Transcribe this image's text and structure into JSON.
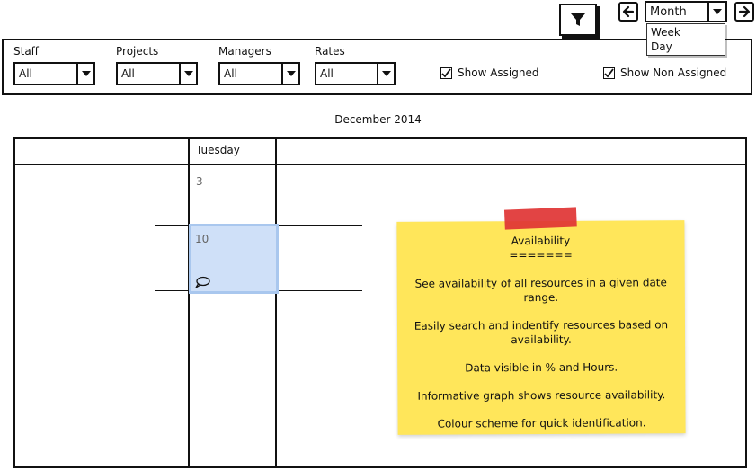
{
  "toolbar": {
    "filter_icon": "filter-icon",
    "prev_icon": "arrow-left-icon",
    "next_icon": "arrow-right-icon",
    "view_select": {
      "value": "Month",
      "options": [
        "Week",
        "Day"
      ]
    }
  },
  "filters": [
    {
      "label": "Staff",
      "value": "All"
    },
    {
      "label": "Projects",
      "value": "All"
    },
    {
      "label": "Managers",
      "value": "All"
    },
    {
      "label": "Rates",
      "value": "All"
    }
  ],
  "checkboxes": [
    {
      "label": "Show Assigned",
      "checked": true
    },
    {
      "label": "Show Non Assigned",
      "checked": true
    }
  ],
  "calendar": {
    "title": "December 2014",
    "day_header": "Tuesday",
    "dates": [
      "3",
      "10"
    ],
    "comment_icon": "speech-bubble-icon"
  },
  "sticky": {
    "title": "Availability",
    "underline": "=======",
    "lines": [
      "See availability of all resources in a given date range.",
      "Easily search and indentify resources based on availability.",
      "Data visible in % and Hours.",
      "Informative graph shows resource availability.",
      "Colour scheme for quick identification."
    ]
  },
  "colors": {
    "selection": "#cfe0f8",
    "sticky": "#ffe65a",
    "tape": "#e03434"
  }
}
